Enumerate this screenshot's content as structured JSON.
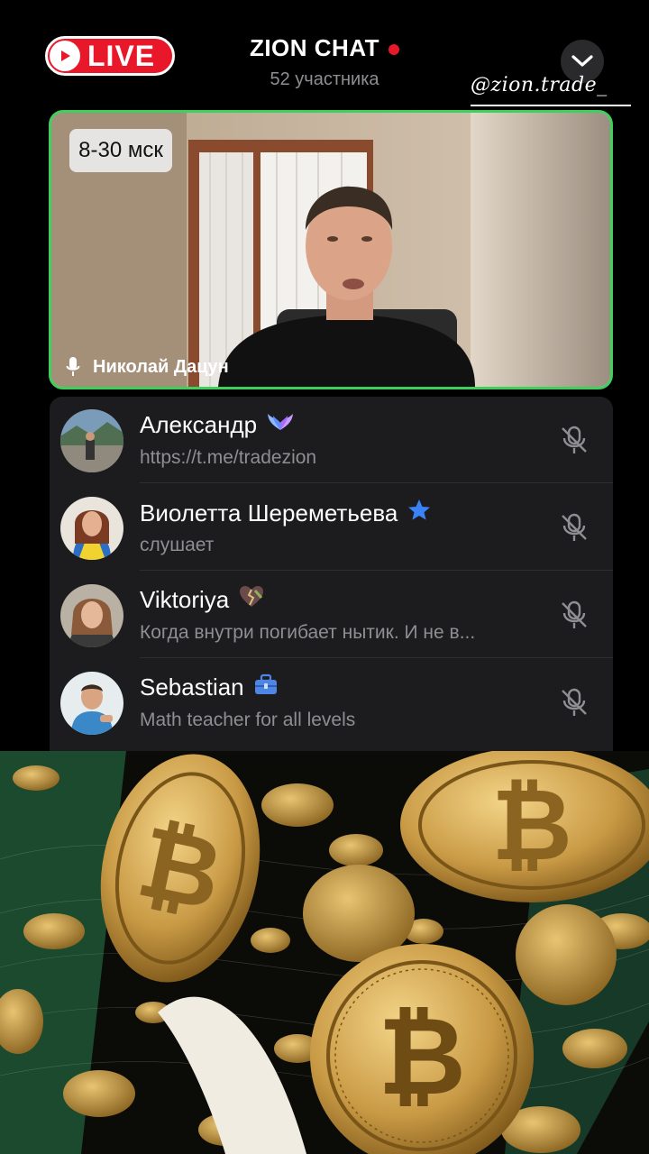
{
  "header": {
    "live_label": "LIVE",
    "title": "ZION CHAT",
    "subtitle": "52 участника",
    "watermark": "@zion.trade_"
  },
  "video": {
    "time_badge": "8-30 мск",
    "speaker": "Николай Дацун"
  },
  "participants": [
    {
      "name": "Александр",
      "status": "https://t.me/tradezion",
      "badge": "wings-icon"
    },
    {
      "name": "Виолетта Шереметьева",
      "status": "слушает",
      "badge": "star-icon"
    },
    {
      "name": "Viktoriya",
      "status": "Когда внутри погибает нытик. И не в...",
      "badge": "broken-heart-icon"
    },
    {
      "name": "Sebastian",
      "status": "Math teacher for all levels",
      "badge": "briefcase-icon"
    }
  ],
  "colors": {
    "live_red": "#e8182a",
    "active_speaker_border": "#3ecf5c",
    "panel_bg": "#1c1c1e",
    "secondary_text": "#8e8e93",
    "star_blue": "#3b82f6"
  }
}
